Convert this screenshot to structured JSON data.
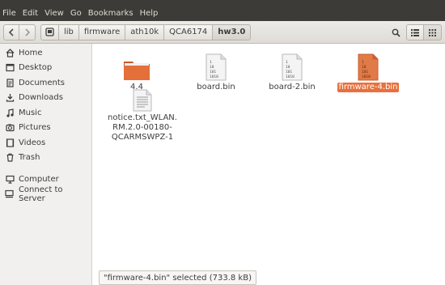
{
  "menu": [
    "File",
    "Edit",
    "View",
    "Go",
    "Bookmarks",
    "Help"
  ],
  "breadcrumb": [
    "lib",
    "firmware",
    "ath10k",
    "QCA6174",
    "hw3.0"
  ],
  "sidebar": {
    "places": [
      {
        "label": "Home",
        "icon": "home-icon"
      },
      {
        "label": "Desktop",
        "icon": "desktop-icon"
      },
      {
        "label": "Documents",
        "icon": "documents-icon"
      },
      {
        "label": "Downloads",
        "icon": "downloads-icon"
      },
      {
        "label": "Music",
        "icon": "music-icon"
      },
      {
        "label": "Pictures",
        "icon": "pictures-icon"
      },
      {
        "label": "Videos",
        "icon": "videos-icon"
      },
      {
        "label": "Trash",
        "icon": "trash-icon"
      }
    ],
    "devices": [
      {
        "label": "Computer",
        "icon": "computer-icon"
      },
      {
        "label": "Connect to Server",
        "icon": "server-icon"
      }
    ]
  },
  "files": [
    {
      "name": "4.4",
      "type": "folder",
      "selected": false
    },
    {
      "name": "board.bin",
      "type": "binary",
      "selected": false
    },
    {
      "name": "board-2.bin",
      "type": "binary",
      "selected": false
    },
    {
      "name": "firmware-4.bin",
      "type": "binary",
      "selected": true
    },
    {
      "name_lines": [
        "notice.txt_WLAN.",
        "RM.2.0-00180-",
        "QCARMSWPZ-1"
      ],
      "type": "text",
      "selected": false
    }
  ],
  "binary_glyph": [
    "1",
    "10",
    "101",
    "1010"
  ],
  "status": "\"firmware-4.bin\" selected  (733.8 kB)",
  "colors": {
    "accent": "#e8703d",
    "folder": "#e46f3b",
    "menubar": "#3c3b37"
  }
}
